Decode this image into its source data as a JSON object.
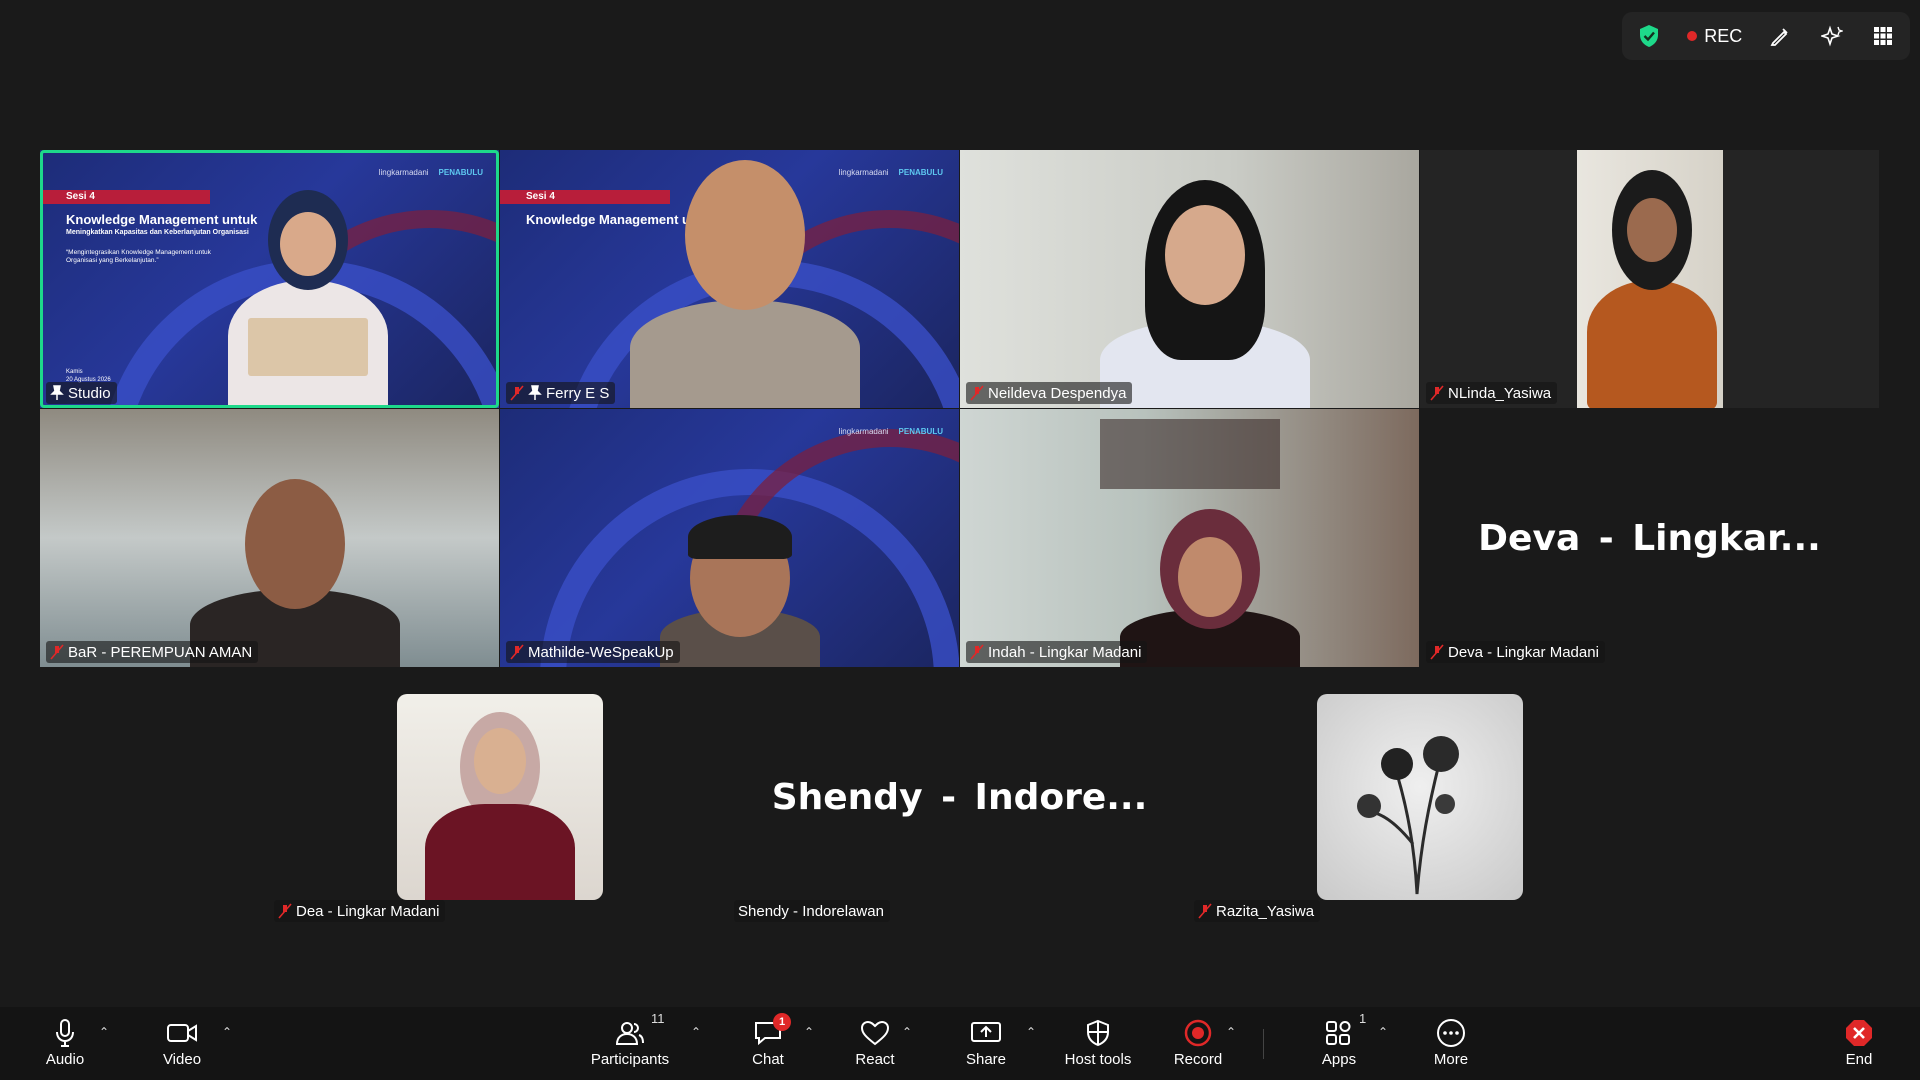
{
  "top_controls": {
    "rec_label": "REC"
  },
  "slide": {
    "session": "Sesi 4",
    "title": "Knowledge Management untuk",
    "subtitle": "Meningkatkan Kapasitas dan Keberlanjutan Organisasi",
    "quote": "“Mengintegrasikan Knowledge Management untuk Organisasi yang Berkelanjutan.”",
    "date_line1": "Kamis",
    "date_line2": "20 Agustus 2026",
    "logo1": "lingkarmadani",
    "logo2": "PENABULU"
  },
  "tiles": [
    {
      "name": "Studio",
      "mic": "pinned"
    },
    {
      "name": "Ferry E S",
      "mic": "muted-pinned"
    },
    {
      "name": "Neildeva Despendya",
      "mic": "muted"
    },
    {
      "name": "NLinda_Yasiwa",
      "mic": "muted"
    },
    {
      "name": "BaR - PEREMPUAN AMAN",
      "mic": "muted"
    },
    {
      "name": "Mathilde-WeSpeakUp",
      "mic": "muted"
    },
    {
      "name": "Indah - Lingkar Madani",
      "mic": "muted"
    },
    {
      "name": "Deva - Lingkar Madani",
      "mic": "muted",
      "big": "Deva - Lingkar..."
    },
    {
      "name": "Dea - Lingkar Madani",
      "mic": "muted"
    },
    {
      "name": "Shendy - Indorelawan",
      "mic": "none",
      "big": "Shendy - Indore..."
    },
    {
      "name": "Razita_Yasiwa",
      "mic": "muted"
    }
  ],
  "toolbar": {
    "audio": "Audio",
    "video": "Video",
    "participants": "Participants",
    "participants_count": "11",
    "chat": "Chat",
    "chat_badge": "1",
    "react": "React",
    "share": "Share",
    "host_tools": "Host tools",
    "record": "Record",
    "apps": "Apps",
    "apps_count": "1",
    "more": "More",
    "end": "End"
  },
  "colors": {
    "active_speaker_border": "#1ed98a",
    "muted_red": "#e02828",
    "background": "#1a1a1a",
    "toolbar": "#141414"
  }
}
